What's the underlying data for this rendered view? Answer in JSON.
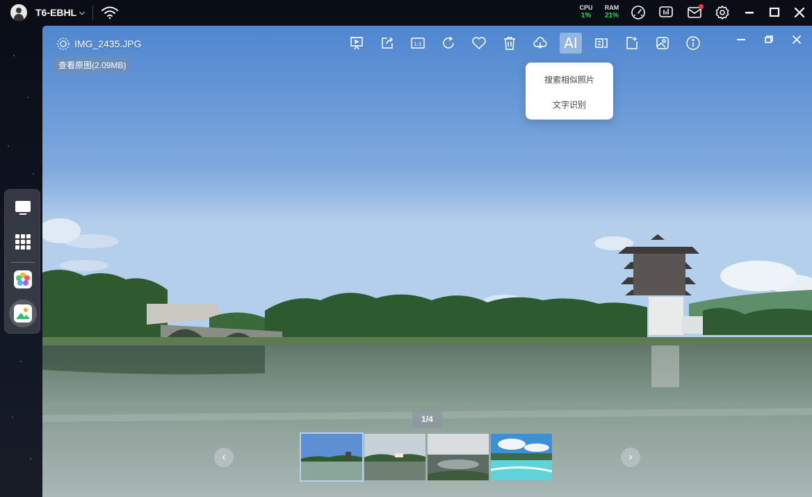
{
  "topbar": {
    "device_name": "T6-EBHL",
    "cpu_label": "CPU",
    "cpu_value": "1%",
    "ram_label": "RAM",
    "ram_value": "21%",
    "icons": [
      "wifi-icon",
      "speedometer-icon",
      "monitor-icon",
      "mail-icon",
      "gear-icon",
      "minimize-icon",
      "maximize-icon",
      "close-icon"
    ]
  },
  "dock": {
    "items": [
      "desktop-icon",
      "apps-grid-icon",
      "photos-app-icon",
      "image-viewer-icon"
    ]
  },
  "viewer": {
    "filename": "IMG_2435.JPG",
    "view_original_label": "查看原图(2.09MB)",
    "toolbar": {
      "icons": [
        "slideshow-icon",
        "share-icon",
        "actual-size-icon",
        "rotate-icon",
        "favorite-icon",
        "delete-icon",
        "cloud-icon",
        "ai-button",
        "compare-icon",
        "export-icon",
        "set-wallpaper-icon",
        "info-icon"
      ],
      "ai_label": "AI"
    },
    "ai_menu": {
      "item_search_similar": "搜索相似照片",
      "item_text_recognition": "文字识别"
    },
    "counter": "1/4",
    "thumbnails_count": 4
  },
  "colors": {
    "accent_green": "#1ed760",
    "notification_red": "#ff3b30",
    "sky_top": "#4f86cf",
    "sky_bottom": "#c4dcf0"
  }
}
